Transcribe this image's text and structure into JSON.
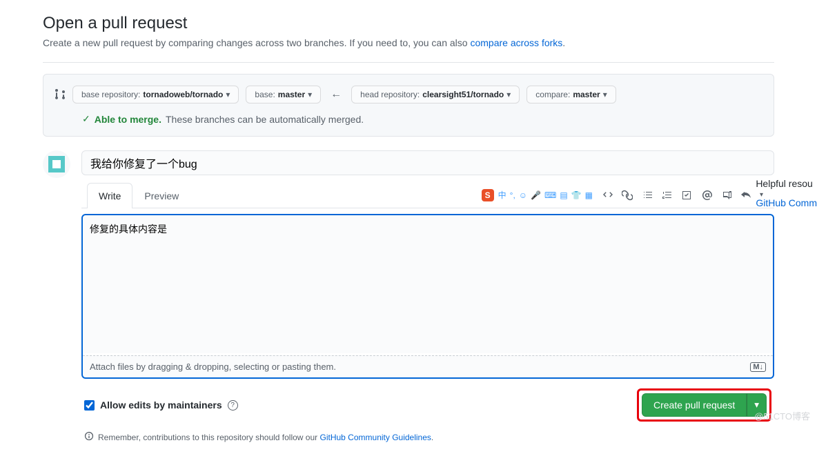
{
  "header": {
    "title": "Open a pull request",
    "subtitle_text": "Create a new pull request by comparing changes across two branches. If you need to, you can also ",
    "subtitle_link": "compare across forks"
  },
  "compare": {
    "base_repo_label": "base repository: ",
    "base_repo_value": "tornadoweb/tornado",
    "base_branch_label": "base: ",
    "base_branch_value": "master",
    "head_repo_label": "head repository: ",
    "head_repo_value": "clearsight51/tornado",
    "compare_branch_label": "compare: ",
    "compare_branch_value": "master",
    "able_label": "Able to merge.",
    "able_desc": "These branches can be automatically merged."
  },
  "form": {
    "title_value": "我给你修复了一个bug",
    "tab_write": "Write",
    "tab_preview": "Preview",
    "body_value": "修复的具体内容是",
    "attach_hint": "Attach files by dragging & dropping, selecting or pasting them.",
    "allow_edits_label": "Allow edits by maintainers",
    "submit_label": "Create pull request"
  },
  "ime": {
    "char": "中"
  },
  "footer": {
    "remember_text": "Remember, contributions to this repository should follow our ",
    "guidelines_link": "GitHub Community Guidelines"
  },
  "sidebar": {
    "helpful": "Helpful resou",
    "community": "GitHub Comm"
  },
  "watermark": "@51CTO博客"
}
